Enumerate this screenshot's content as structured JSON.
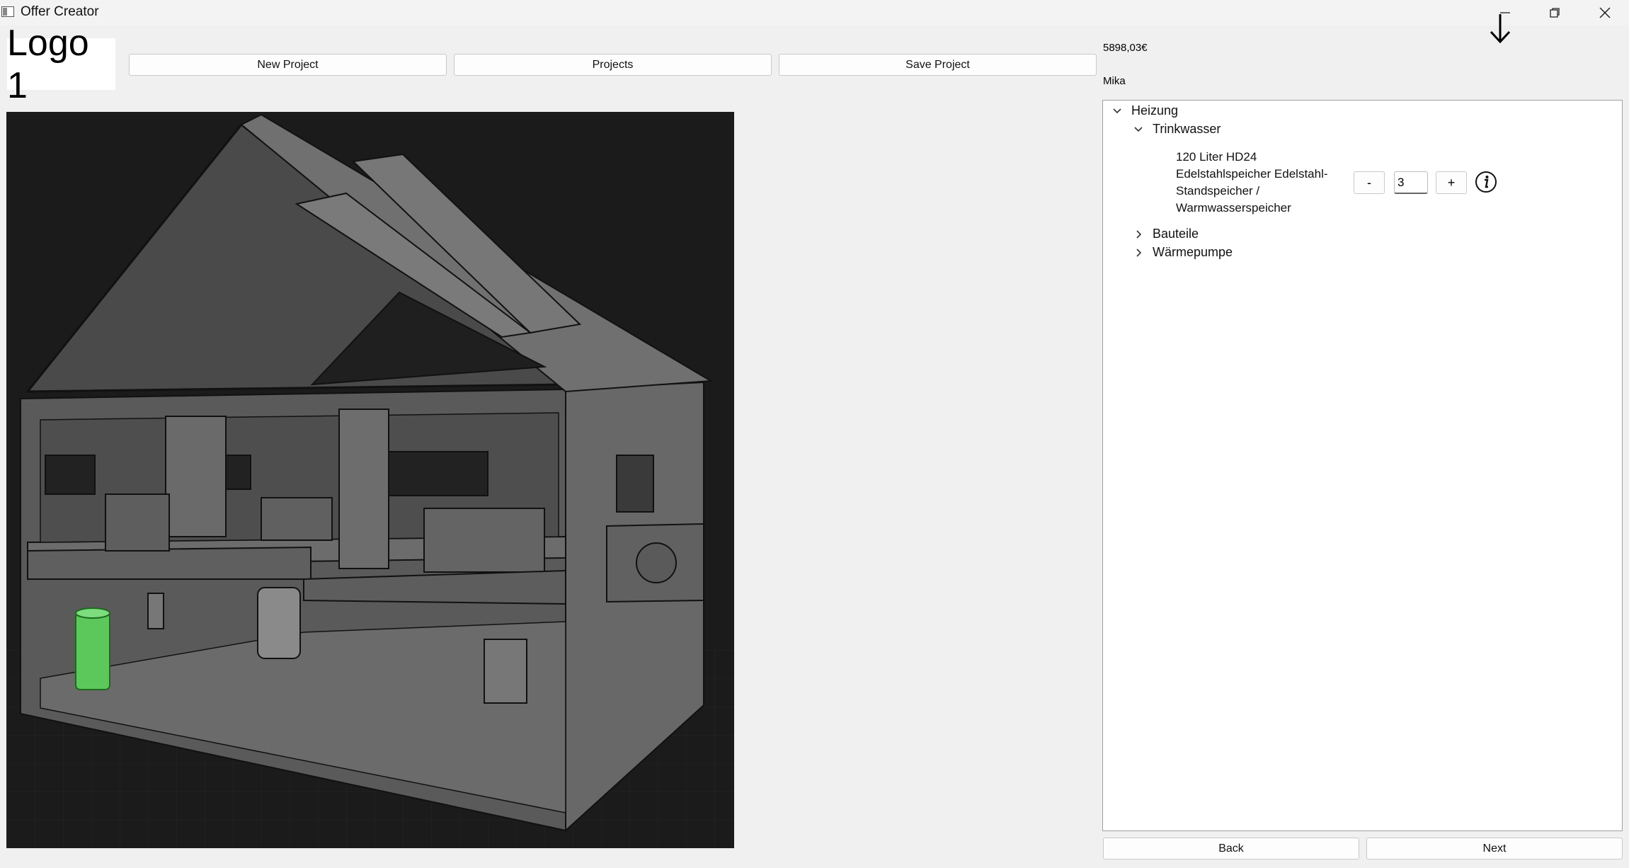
{
  "window": {
    "title": "Offer Creator",
    "app_icon": "app-window-icon",
    "controls": [
      "minimize-icon",
      "restore-icon",
      "close-icon"
    ]
  },
  "overlay_icon": "down-arrow-icon",
  "logo": {
    "text": "Logo 1"
  },
  "toolbar": {
    "new_project": "New Project",
    "projects": "Projects",
    "save_project": "Save Project"
  },
  "summary": {
    "price": "5898,03€",
    "user": "Mika"
  },
  "scene": {
    "description_icon": "house-cutaway-3d-view",
    "highlight_color": "#5cc85c"
  },
  "tree": {
    "root": {
      "label": "Heizung",
      "expanded": true
    },
    "children": [
      {
        "label": "Trinkwasser",
        "expanded": true,
        "item": {
          "description": "120 Liter HD24 Edelstahlspeicher Edelstahl-Standspeicher / Warmwasserspeicher",
          "minus_label": "-",
          "quantity": "3",
          "plus_label": "+",
          "info_icon": "info-icon"
        }
      },
      {
        "label": "Bauteile",
        "expanded": false
      },
      {
        "label": "Wärmepumpe",
        "expanded": false
      }
    ]
  },
  "footer": {
    "back": "Back",
    "next": "Next"
  }
}
